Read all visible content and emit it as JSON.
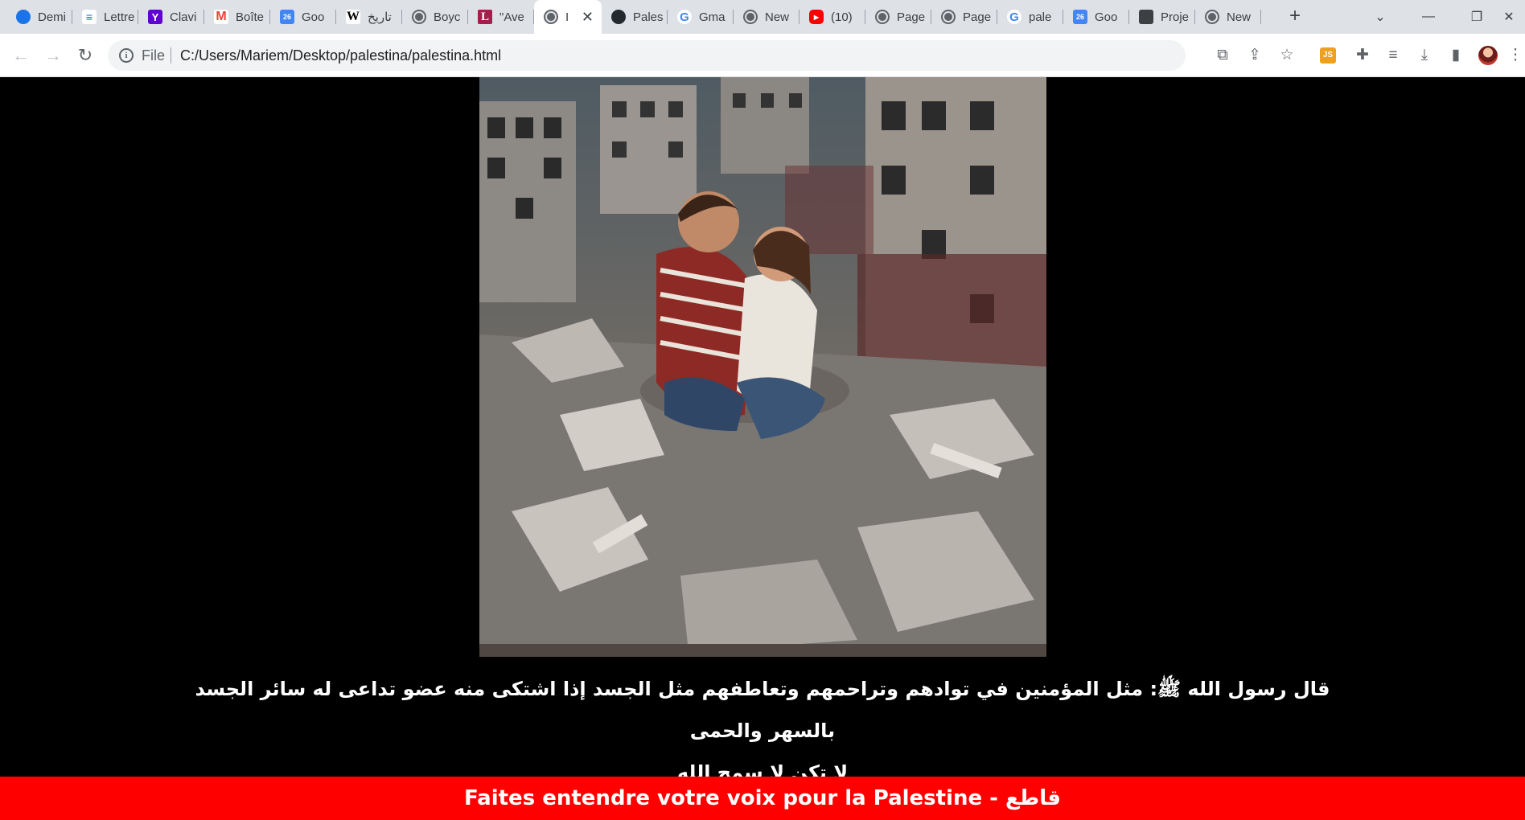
{
  "browser": {
    "tabs": [
      {
        "label": "Demi",
        "icon": "d"
      },
      {
        "label": "Lettre",
        "icon": "lt"
      },
      {
        "label": "Clavi",
        "icon": "y"
      },
      {
        "label": "Boîte",
        "icon": "m"
      },
      {
        "label": "Goo",
        "icon": "cal"
      },
      {
        "label": "تاريخ",
        "icon": "wiki"
      },
      {
        "label": "Boyc",
        "icon": "globe"
      },
      {
        "label": "\"Ave",
        "icon": "l"
      },
      {
        "label": "I",
        "icon": "globe",
        "active": true
      },
      {
        "label": "Pales",
        "icon": "gh"
      },
      {
        "label": "Gma",
        "icon": "g"
      },
      {
        "label": "New",
        "icon": "globe"
      },
      {
        "label": "(10)",
        "icon": "yt"
      },
      {
        "label": "Page",
        "icon": "globe"
      },
      {
        "label": "Page",
        "icon": "globe"
      },
      {
        "label": "pale",
        "icon": "g"
      },
      {
        "label": "Goo",
        "icon": "cal"
      },
      {
        "label": "Proje",
        "icon": "prj"
      },
      {
        "label": "New",
        "icon": "globe"
      }
    ],
    "address": {
      "scheme_label": "File",
      "url": "C:/Users/Mariem/Desktop/palestina/palestina.html"
    },
    "extension_badge": "JS"
  },
  "page": {
    "quote_line1": "قال رسول الله ﷺ: مثل المؤمنين في توادهم وتراحمهم وتعاطفهم مثل الجسد إذا اشتكى منه عضو تداعى له سائر الجسد بالسهر والحمى",
    "quote_line2": "لا تكن لا سمح الله",
    "banner_text": "قاطع - Faites entendre votre voix pour la Palestine"
  }
}
